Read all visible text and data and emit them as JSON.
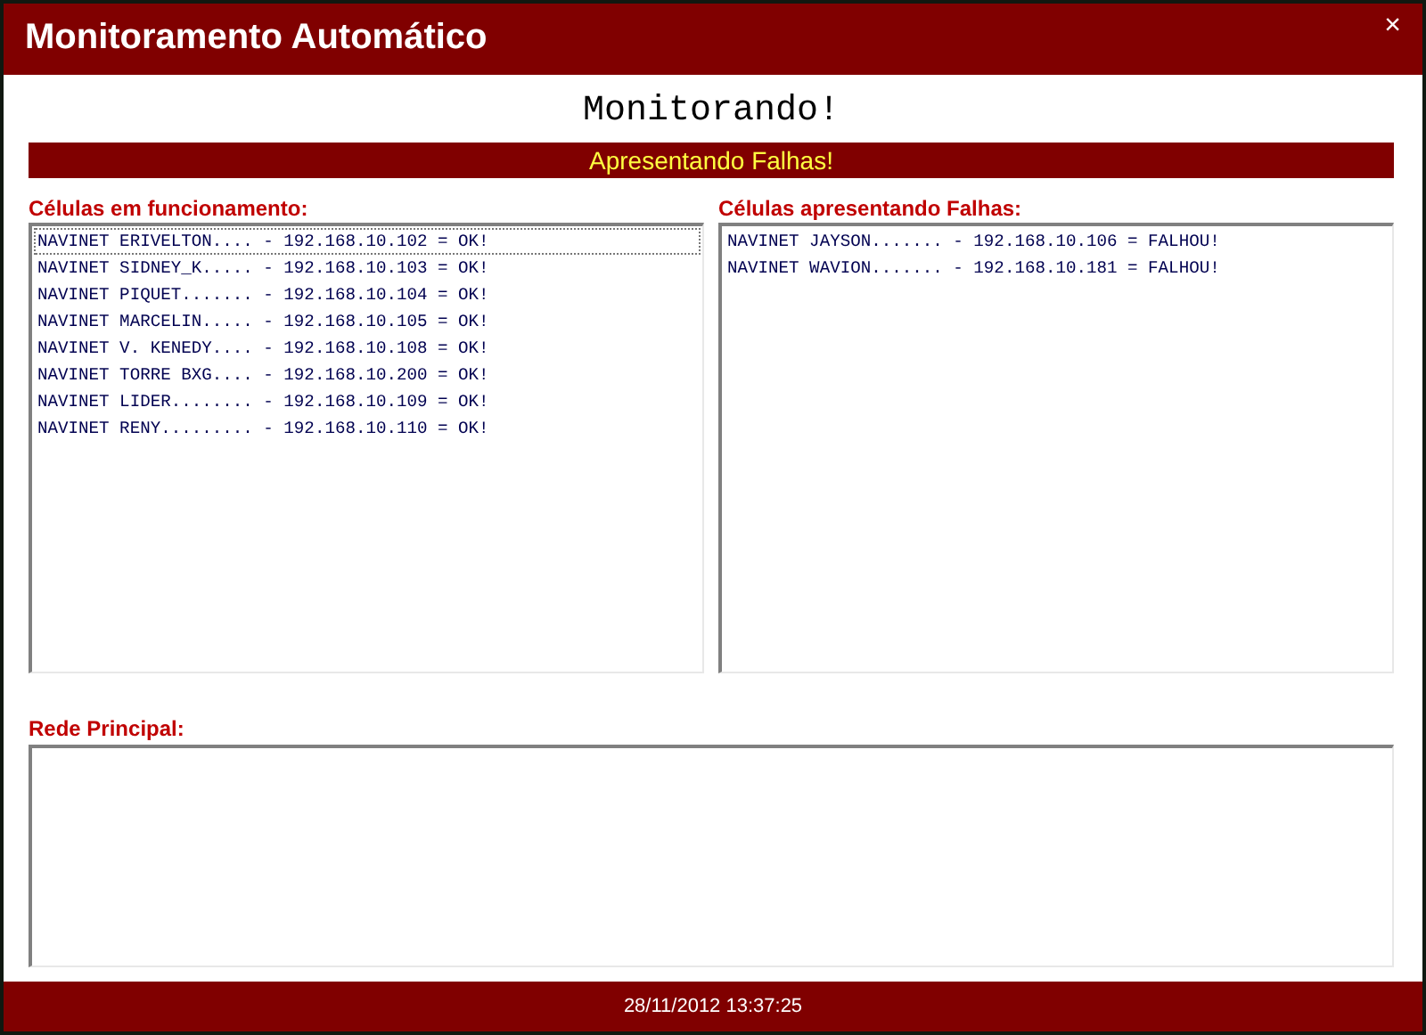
{
  "window": {
    "title": "Monitoramento Automático",
    "close": "×"
  },
  "heading": "Monitorando!",
  "alert_banner": "Apresentando Falhas!",
  "working_cells": {
    "label": "Células em funcionamento:",
    "items": [
      {
        "text": "NAVINET ERIVELTON.... - 192.168.10.102 = OK!",
        "focused": true
      },
      {
        "text": "NAVINET SIDNEY_K..... - 192.168.10.103 = OK!",
        "focused": false
      },
      {
        "text": "NAVINET PIQUET....... - 192.168.10.104 = OK!",
        "focused": false
      },
      {
        "text": "NAVINET MARCELIN..... - 192.168.10.105 = OK!",
        "focused": false
      },
      {
        "text": "NAVINET V. KENEDY.... - 192.168.10.108 = OK!",
        "focused": false
      },
      {
        "text": "NAVINET TORRE BXG.... - 192.168.10.200 = OK!",
        "focused": false
      },
      {
        "text": "NAVINET LIDER........ - 192.168.10.109 = OK!",
        "focused": false
      },
      {
        "text": "NAVINET RENY......... - 192.168.10.110 = OK!",
        "focused": false
      }
    ]
  },
  "failing_cells": {
    "label": "Células apresentando Falhas:",
    "items": [
      {
        "text": "NAVINET JAYSON....... - 192.168.10.106 = FALHOU!",
        "focused": false
      },
      {
        "text": "NAVINET WAVION....... - 192.168.10.181 = FALHOU!",
        "focused": false
      }
    ]
  },
  "main_network": {
    "label": "Rede Principal:"
  },
  "status_bar": "28/11/2012 13:37:25"
}
